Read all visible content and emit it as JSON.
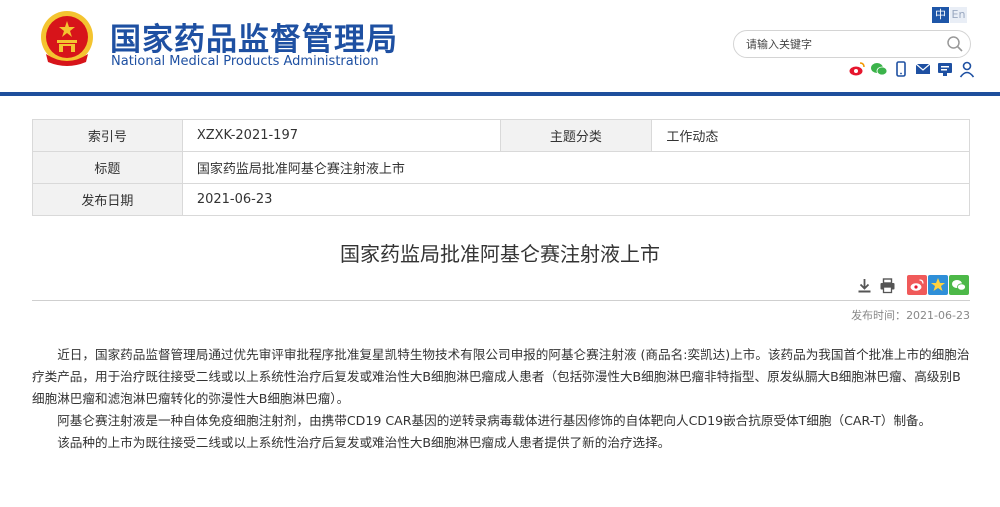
{
  "header": {
    "site_name_cn": "国家药品监督管理局",
    "site_name_en": "National Medical Products Administration",
    "lang_zh": "中",
    "lang_en": "En",
    "search_placeholder": "请输入关键字",
    "search_value": "",
    "social_icons": [
      "weibo-icon",
      "wechat-icon",
      "mobile-icon",
      "mail-icon",
      "app-icon",
      "user-icon"
    ]
  },
  "meta": {
    "index_label": "索引号",
    "index_value": "XZXK-2021-197",
    "category_label": "主题分类",
    "category_value": "工作动态",
    "title_label": "标题",
    "title_value": "国家药监局批准阿基仑赛注射液上市",
    "date_label": "发布日期",
    "date_value": "2021-06-23"
  },
  "article": {
    "title": "国家药监局批准阿基仑赛注射液上市",
    "pubtime_label": "发布时间：",
    "pubtime_value": "2021-06-23",
    "paragraphs": [
      "近日，国家药品监督管理局通过优先审评审批程序批准复星凯特生物技术有限公司申报的阿基仑赛注射液 (商品名:奕凯达)上市。该药品为我国首个批准上市的细胞治疗类产品，用于治疗既往接受二线或以上系统性治疗后复发或难治性大B细胞淋巴瘤成人患者（包括弥漫性大B细胞淋巴瘤非特指型、原发纵膈大B细胞淋巴瘤、高级别B细胞淋巴瘤和滤泡淋巴瘤转化的弥漫性大B细胞淋巴瘤）。",
      "阿基仑赛注射液是一种自体免疫细胞注射剂，由携带CD19 CAR基因的逆转录病毒载体进行基因修饰的自体靶向人CD19嵌合抗原受体T细胞（CAR-T）制备。",
      "该品种的上市为既往接受二线或以上系统性治疗后复发或难治性大B细胞淋巴瘤成人患者提供了新的治疗选择。"
    ],
    "tool_icons": [
      "download-icon",
      "print-icon",
      "weibo-share-icon",
      "favorite-icon",
      "wechat-share-icon"
    ]
  },
  "colors": {
    "brand_blue": "#1e50a2",
    "header_bar": "#1e4f9c",
    "emblem_red": "#d7141a",
    "emblem_gold": "#f4c430"
  }
}
